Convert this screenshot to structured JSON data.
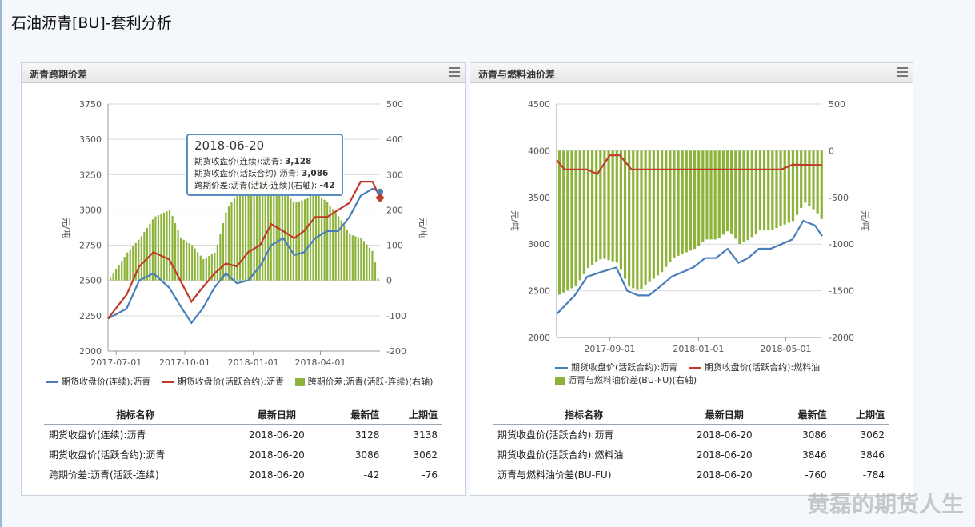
{
  "page": {
    "title": "石油沥青[BU]-套利分析"
  },
  "watermark": "黄磊的期货人生",
  "panels": [
    {
      "title": "沥青跨期价差",
      "y_left_ticks": [
        "3750",
        "3500",
        "3250",
        "3000",
        "2750",
        "2500",
        "2250",
        "2000"
      ],
      "y_right_ticks": [
        "500",
        "400",
        "300",
        "200",
        "100",
        "0",
        "-100",
        "-200"
      ],
      "y_left_label": "元/吨",
      "y_right_label": "元/吨",
      "x_ticks": [
        "2017-07-01",
        "2017-10-01",
        "2018-01-01",
        "2018-04-01"
      ],
      "legend": [
        "期货收盘价(连续):沥青",
        "期货收盘价(活跃合约):沥青",
        "跨期价差:沥青(活跃-连续)(右轴)"
      ],
      "tooltip": {
        "date": "2018-06-20",
        "lines": [
          {
            "label": "期货收盘价(连续):沥青:",
            "value": "3,128"
          },
          {
            "label": "期货收盘价(活跃合约):沥青:",
            "value": "3,086"
          },
          {
            "label": "跨期价差:沥青(活跃-连续)(右轴):",
            "value": "-42"
          }
        ]
      },
      "table": {
        "headers": [
          "指标名称",
          "最新日期",
          "最新值",
          "上期值"
        ],
        "rows": [
          [
            "期货收盘价(连续):沥青",
            "2018-06-20",
            "3128",
            "3138"
          ],
          [
            "期货收盘价(活跃合约):沥青",
            "2018-06-20",
            "3086",
            "3062"
          ],
          [
            "跨期价差:沥青(活跃-连续)",
            "2018-06-20",
            "-42",
            "-76"
          ]
        ]
      }
    },
    {
      "title": "沥青与燃料油价差",
      "y_left_ticks": [
        "4500",
        "4000",
        "3500",
        "3000",
        "2500",
        "2000"
      ],
      "y_right_ticks": [
        "500",
        "0",
        "-500",
        "-1000",
        "-1500",
        "-2000"
      ],
      "y_left_label": "元/吨",
      "y_right_label": "元/吨",
      "x_ticks": [
        "2017-09-01",
        "2018-01-01",
        "2018-05-01"
      ],
      "legend": [
        "期货收盘价(活跃合约):沥青",
        "期货收盘价(活跃合约):燃料油",
        "沥青与燃料油价差(BU-FU)(右轴)"
      ],
      "table": {
        "headers": [
          "指标名称",
          "最新日期",
          "最新值",
          "上期值"
        ],
        "rows": [
          [
            "期货收盘价(活跃合约):沥青",
            "2018-06-20",
            "3086",
            "3062"
          ],
          [
            "期货收盘价(活跃合约):燃料油",
            "2018-06-20",
            "3846",
            "3846"
          ],
          [
            "沥青与燃料油价差(BU-FU)",
            "2018-06-20",
            "-760",
            "-784"
          ]
        ]
      }
    }
  ],
  "colors": {
    "blue": "#4a7ebb",
    "red": "#c0392b",
    "green": "#8db33a",
    "grid": "#d9d9d9"
  },
  "chart_data": [
    {
      "type": "line",
      "title": "沥青跨期价差",
      "x_range": [
        "2017-06-20",
        "2018-06-20"
      ],
      "ylim_left": [
        2000,
        3750
      ],
      "ylim_right": [
        -200,
        500
      ],
      "series": [
        {
          "name": "期货收盘价(连续):沥青",
          "axis": "left",
          "x": [
            "2017-06-20",
            "2017-07-15",
            "2017-08-01",
            "2017-08-20",
            "2017-09-10",
            "2017-09-25",
            "2017-10-10",
            "2017-10-25",
            "2017-11-10",
            "2017-11-25",
            "2017-12-10",
            "2017-12-25",
            "2018-01-10",
            "2018-01-25",
            "2018-02-10",
            "2018-02-25",
            "2018-03-10",
            "2018-03-25",
            "2018-04-10",
            "2018-04-25",
            "2018-05-10",
            "2018-05-25",
            "2018-06-10",
            "2018-06-20"
          ],
          "values": [
            2230,
            2300,
            2500,
            2550,
            2450,
            2320,
            2200,
            2300,
            2450,
            2550,
            2480,
            2500,
            2600,
            2750,
            2800,
            2680,
            2700,
            2800,
            2850,
            2850,
            2950,
            3100,
            3150,
            3128
          ]
        },
        {
          "name": "期货收盘价(活跃合约):沥青",
          "axis": "left",
          "x": [
            "2017-06-20",
            "2017-07-15",
            "2017-08-01",
            "2017-08-20",
            "2017-09-10",
            "2017-09-25",
            "2017-10-10",
            "2017-10-25",
            "2017-11-10",
            "2017-11-25",
            "2017-12-10",
            "2017-12-25",
            "2018-01-10",
            "2018-01-25",
            "2018-02-10",
            "2018-02-25",
            "2018-03-10",
            "2018-03-25",
            "2018-04-10",
            "2018-04-25",
            "2018-05-10",
            "2018-05-25",
            "2018-06-10",
            "2018-06-20"
          ],
          "values": [
            2230,
            2400,
            2600,
            2700,
            2650,
            2500,
            2350,
            2450,
            2550,
            2620,
            2600,
            2700,
            2750,
            2900,
            2850,
            2800,
            2850,
            2950,
            2950,
            3000,
            3050,
            3200,
            3200,
            3086
          ]
        },
        {
          "name": "跨期价差:沥青(活跃-连续)(右轴)",
          "axis": "right",
          "type": "bar",
          "x": [
            "2017-06-20",
            "2017-07-15",
            "2017-08-01",
            "2017-08-20",
            "2017-09-10",
            "2017-09-25",
            "2017-10-10",
            "2017-10-25",
            "2017-11-10",
            "2017-11-25",
            "2017-12-10",
            "2017-12-25",
            "2018-01-10",
            "2018-01-25",
            "2018-02-10",
            "2018-02-25",
            "2018-03-10",
            "2018-03-25",
            "2018-04-10",
            "2018-04-25",
            "2018-05-10",
            "2018-05-25",
            "2018-06-10",
            "2018-06-20"
          ],
          "values": [
            0,
            80,
            120,
            180,
            200,
            120,
            100,
            60,
            80,
            200,
            250,
            280,
            300,
            350,
            250,
            220,
            230,
            250,
            220,
            180,
            130,
            120,
            80,
            -42
          ]
        }
      ]
    },
    {
      "type": "line",
      "title": "沥青与燃料油价差",
      "x_range": [
        "2017-06-20",
        "2018-06-20"
      ],
      "ylim_left": [
        2000,
        4500
      ],
      "ylim_right": [
        -2000,
        500
      ],
      "series": [
        {
          "name": "期货收盘价(活跃合约):沥青",
          "axis": "left",
          "x": [
            "2017-06-20",
            "2017-07-15",
            "2017-08-01",
            "2017-08-20",
            "2017-09-10",
            "2017-09-25",
            "2017-10-10",
            "2017-10-25",
            "2017-11-10",
            "2017-11-25",
            "2017-12-10",
            "2017-12-25",
            "2018-01-10",
            "2018-01-25",
            "2018-02-10",
            "2018-02-25",
            "2018-03-10",
            "2018-03-25",
            "2018-04-10",
            "2018-04-25",
            "2018-05-10",
            "2018-05-25",
            "2018-06-10",
            "2018-06-20"
          ],
          "values": [
            2250,
            2450,
            2650,
            2700,
            2750,
            2500,
            2450,
            2450,
            2550,
            2650,
            2700,
            2750,
            2850,
            2850,
            2950,
            2800,
            2850,
            2950,
            2950,
            3000,
            3050,
            3250,
            3200,
            3086
          ]
        },
        {
          "name": "期货收盘价(活跃合约):燃料油",
          "axis": "left",
          "x": [
            "2017-06-20",
            "2017-07-01",
            "2017-08-01",
            "2017-08-15",
            "2017-09-01",
            "2017-09-15",
            "2017-10-01",
            "2017-12-01",
            "2018-03-01",
            "2018-04-25",
            "2018-05-10",
            "2018-06-20"
          ],
          "values": [
            3900,
            3800,
            3800,
            3750,
            3950,
            3950,
            3800,
            3800,
            3800,
            3800,
            3850,
            3846
          ]
        },
        {
          "name": "沥青与燃料油价差(BU-FU)(右轴)",
          "axis": "right",
          "type": "bar",
          "x": [
            "2017-06-20",
            "2017-07-15",
            "2017-08-01",
            "2017-08-20",
            "2017-09-10",
            "2017-09-25",
            "2017-10-10",
            "2017-10-25",
            "2017-11-10",
            "2017-11-25",
            "2017-12-10",
            "2017-12-25",
            "2018-01-10",
            "2018-01-25",
            "2018-02-10",
            "2018-02-25",
            "2018-03-10",
            "2018-03-25",
            "2018-04-10",
            "2018-04-25",
            "2018-05-10",
            "2018-05-25",
            "2018-06-10",
            "2018-06-20"
          ],
          "values": [
            -1550,
            -1450,
            -1250,
            -1150,
            -1200,
            -1450,
            -1500,
            -1400,
            -1300,
            -1150,
            -1100,
            -1050,
            -950,
            -950,
            -850,
            -1000,
            -950,
            -850,
            -850,
            -800,
            -750,
            -550,
            -650,
            -760
          ]
        }
      ]
    }
  ]
}
